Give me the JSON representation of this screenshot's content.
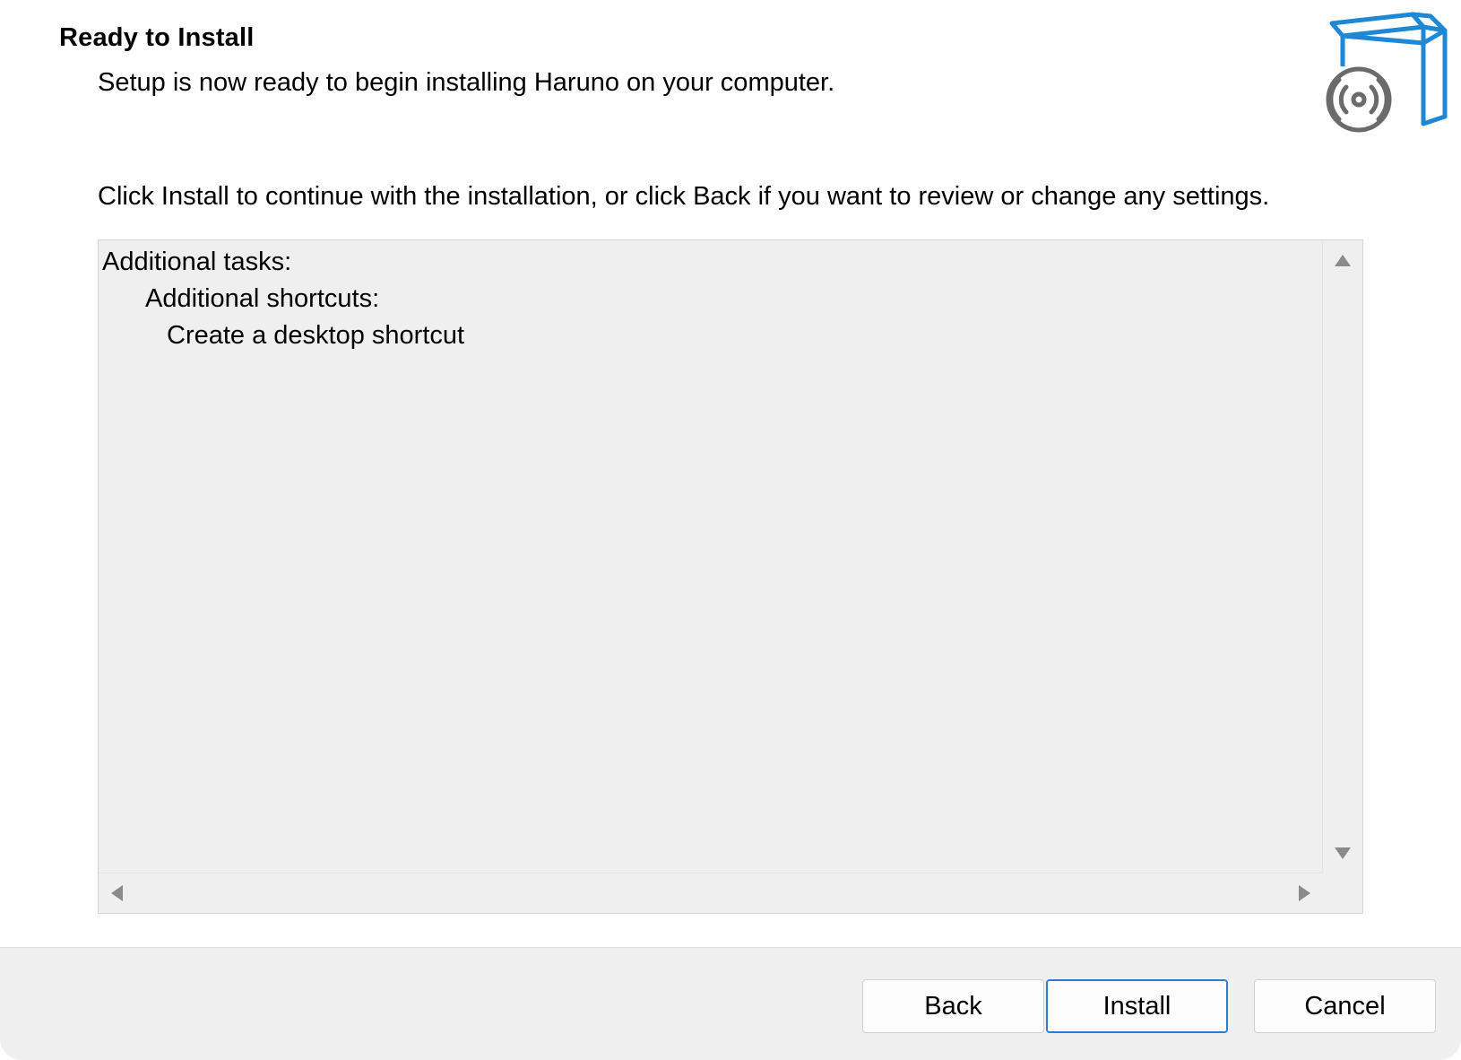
{
  "header": {
    "title": "Ready to Install",
    "subtitle": "Setup is now ready to begin installing Haruno on your computer.",
    "icon": "setup-box-disc-icon"
  },
  "main": {
    "instruction": "Click Install to continue with the installation, or click Back if you want to review or change any settings.",
    "memo": {
      "lines": [
        "Additional tasks:",
        "Additional shortcuts:",
        "Create a desktop shortcut"
      ]
    }
  },
  "footer": {
    "buttons": {
      "back": "Back",
      "install": "Install",
      "cancel": "Cancel"
    }
  },
  "colors": {
    "accent": "#2b7bd1",
    "icon_blue": "#1e88d4",
    "icon_gray": "#6b6b6b",
    "panel_gray": "#efefef"
  }
}
